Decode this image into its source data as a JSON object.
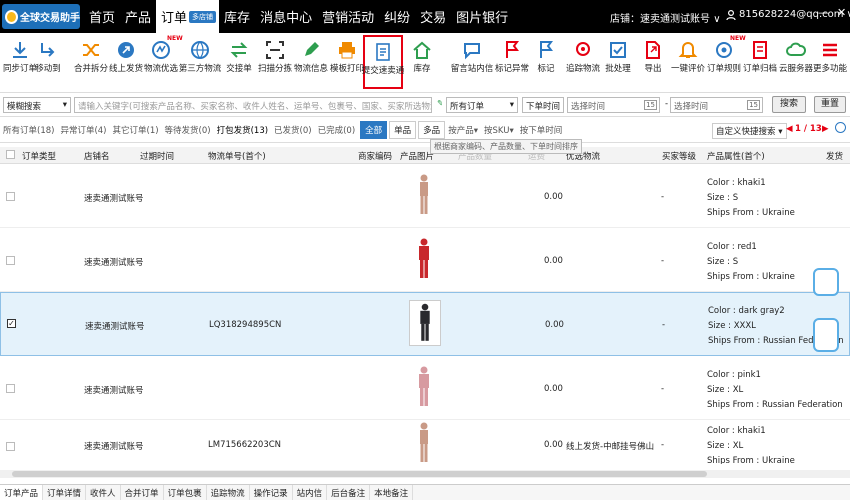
{
  "nav": {
    "logo": "全球交易助手",
    "items": [
      "首页",
      "产品",
      "订单",
      "库存",
      "消息中心",
      "营销活动",
      "纠纷",
      "交易",
      "图片银行"
    ],
    "order_badge": "多店铺",
    "store": "店铺：速卖通测试账号",
    "user": "815628224@qq.com",
    "win": [
      "—",
      "✕"
    ]
  },
  "toolbar": {
    "buttons": [
      "同步订单",
      "移动到",
      "合并拆分",
      "线上发货",
      "物流优选",
      "第三方物流",
      "交接单",
      "扫描分拣",
      "物流信息",
      "模板打印",
      "提交速卖通",
      "库存",
      "留言站内信",
      "标记异常",
      "标记",
      "追踪物流",
      "批处理",
      "导出",
      "一键评价",
      "订单规则",
      "订单归档",
      "云服务器",
      "更多功能"
    ],
    "new_label": "NEW"
  },
  "search": {
    "mode": "模糊搜索",
    "placeholder": "请输入关键字(可搜索产品名称、买家名称、收件人姓名、运单号、包裹号、国家、买家所选物流、商家编码...)",
    "order_filter": "所有订单",
    "time_type": "下单时间",
    "start_time": "选择时间",
    "to": "-",
    "end_time": "选择时间",
    "cal": "15",
    "search_btn": "搜索",
    "reset_btn": "重置"
  },
  "tabs": {
    "items": [
      "所有订单(18)",
      "异常订单(4)",
      "其它订单(1)",
      "等待发货(0)",
      "打包发货(13)",
      "已发货(0)",
      "已完成(0)"
    ],
    "filters": [
      "全部",
      "单品",
      "多品"
    ],
    "sorts": [
      "按产品",
      "按SKU",
      "按下单时间"
    ],
    "quick": "自定义快捷搜索",
    "page": "1 / 13",
    "tooltip": "根据商家编码、产品数量、下单时间排序"
  },
  "table": {
    "headers": [
      "订单类型",
      "店铺名",
      "过期时间",
      "物流单号(首个)",
      "商家编码",
      "产品图片",
      "产品数量",
      "运费",
      "优选物流",
      "买家等级",
      "产品属性(首个)",
      "发货"
    ],
    "rows": [
      {
        "store": "速卖通测试账号",
        "tracking": "",
        "amount": "0.00",
        "logistics": "",
        "level": "-",
        "attrs": [
          "Color : khaki1",
          "Size : S",
          "Ships From : Ukraine"
        ],
        "color": "#c99a86",
        "selected": false,
        "check": ""
      },
      {
        "store": "速卖通测试账号",
        "tracking": "",
        "amount": "0.00",
        "logistics": "",
        "level": "-",
        "attrs": [
          "Color : red1",
          "Size : S",
          "Ships From : Ukraine"
        ],
        "color": "#c8282c",
        "selected": false,
        "check": ""
      },
      {
        "store": "速卖通测试账号",
        "tracking": "LQ318294895CN",
        "amount": "0.00",
        "logistics": "",
        "level": "-",
        "attrs": [
          "Color : dark gray2",
          "Size : XXXL",
          "Ships From : Russian Federation"
        ],
        "color": "#2a2a2e",
        "selected": true,
        "check": "✓"
      },
      {
        "store": "速卖通测试账号",
        "tracking": "",
        "amount": "0.00",
        "logistics": "",
        "level": "-",
        "attrs": [
          "Color : pink1",
          "Size : XL",
          "Ships From : Russian Federation"
        ],
        "color": "#d79aa0",
        "selected": false,
        "check": ""
      },
      {
        "store": "速卖通测试账号",
        "tracking": "LM715662203CN",
        "amount": "0.00",
        "logistics": "线上发货-中邮挂号佛山",
        "level": "-",
        "attrs": [
          "Color : khaki1",
          "Size : XL",
          "Ships From : Ukraine"
        ],
        "color": "#c99a86",
        "selected": false,
        "check": ""
      }
    ]
  },
  "bottom_tabs": [
    "订单产品",
    "订单详情",
    "收件人",
    "合并订单",
    "订单包裹",
    "追踪物流",
    "操作记录",
    "站内信",
    "后台备注",
    "本地备注"
  ]
}
